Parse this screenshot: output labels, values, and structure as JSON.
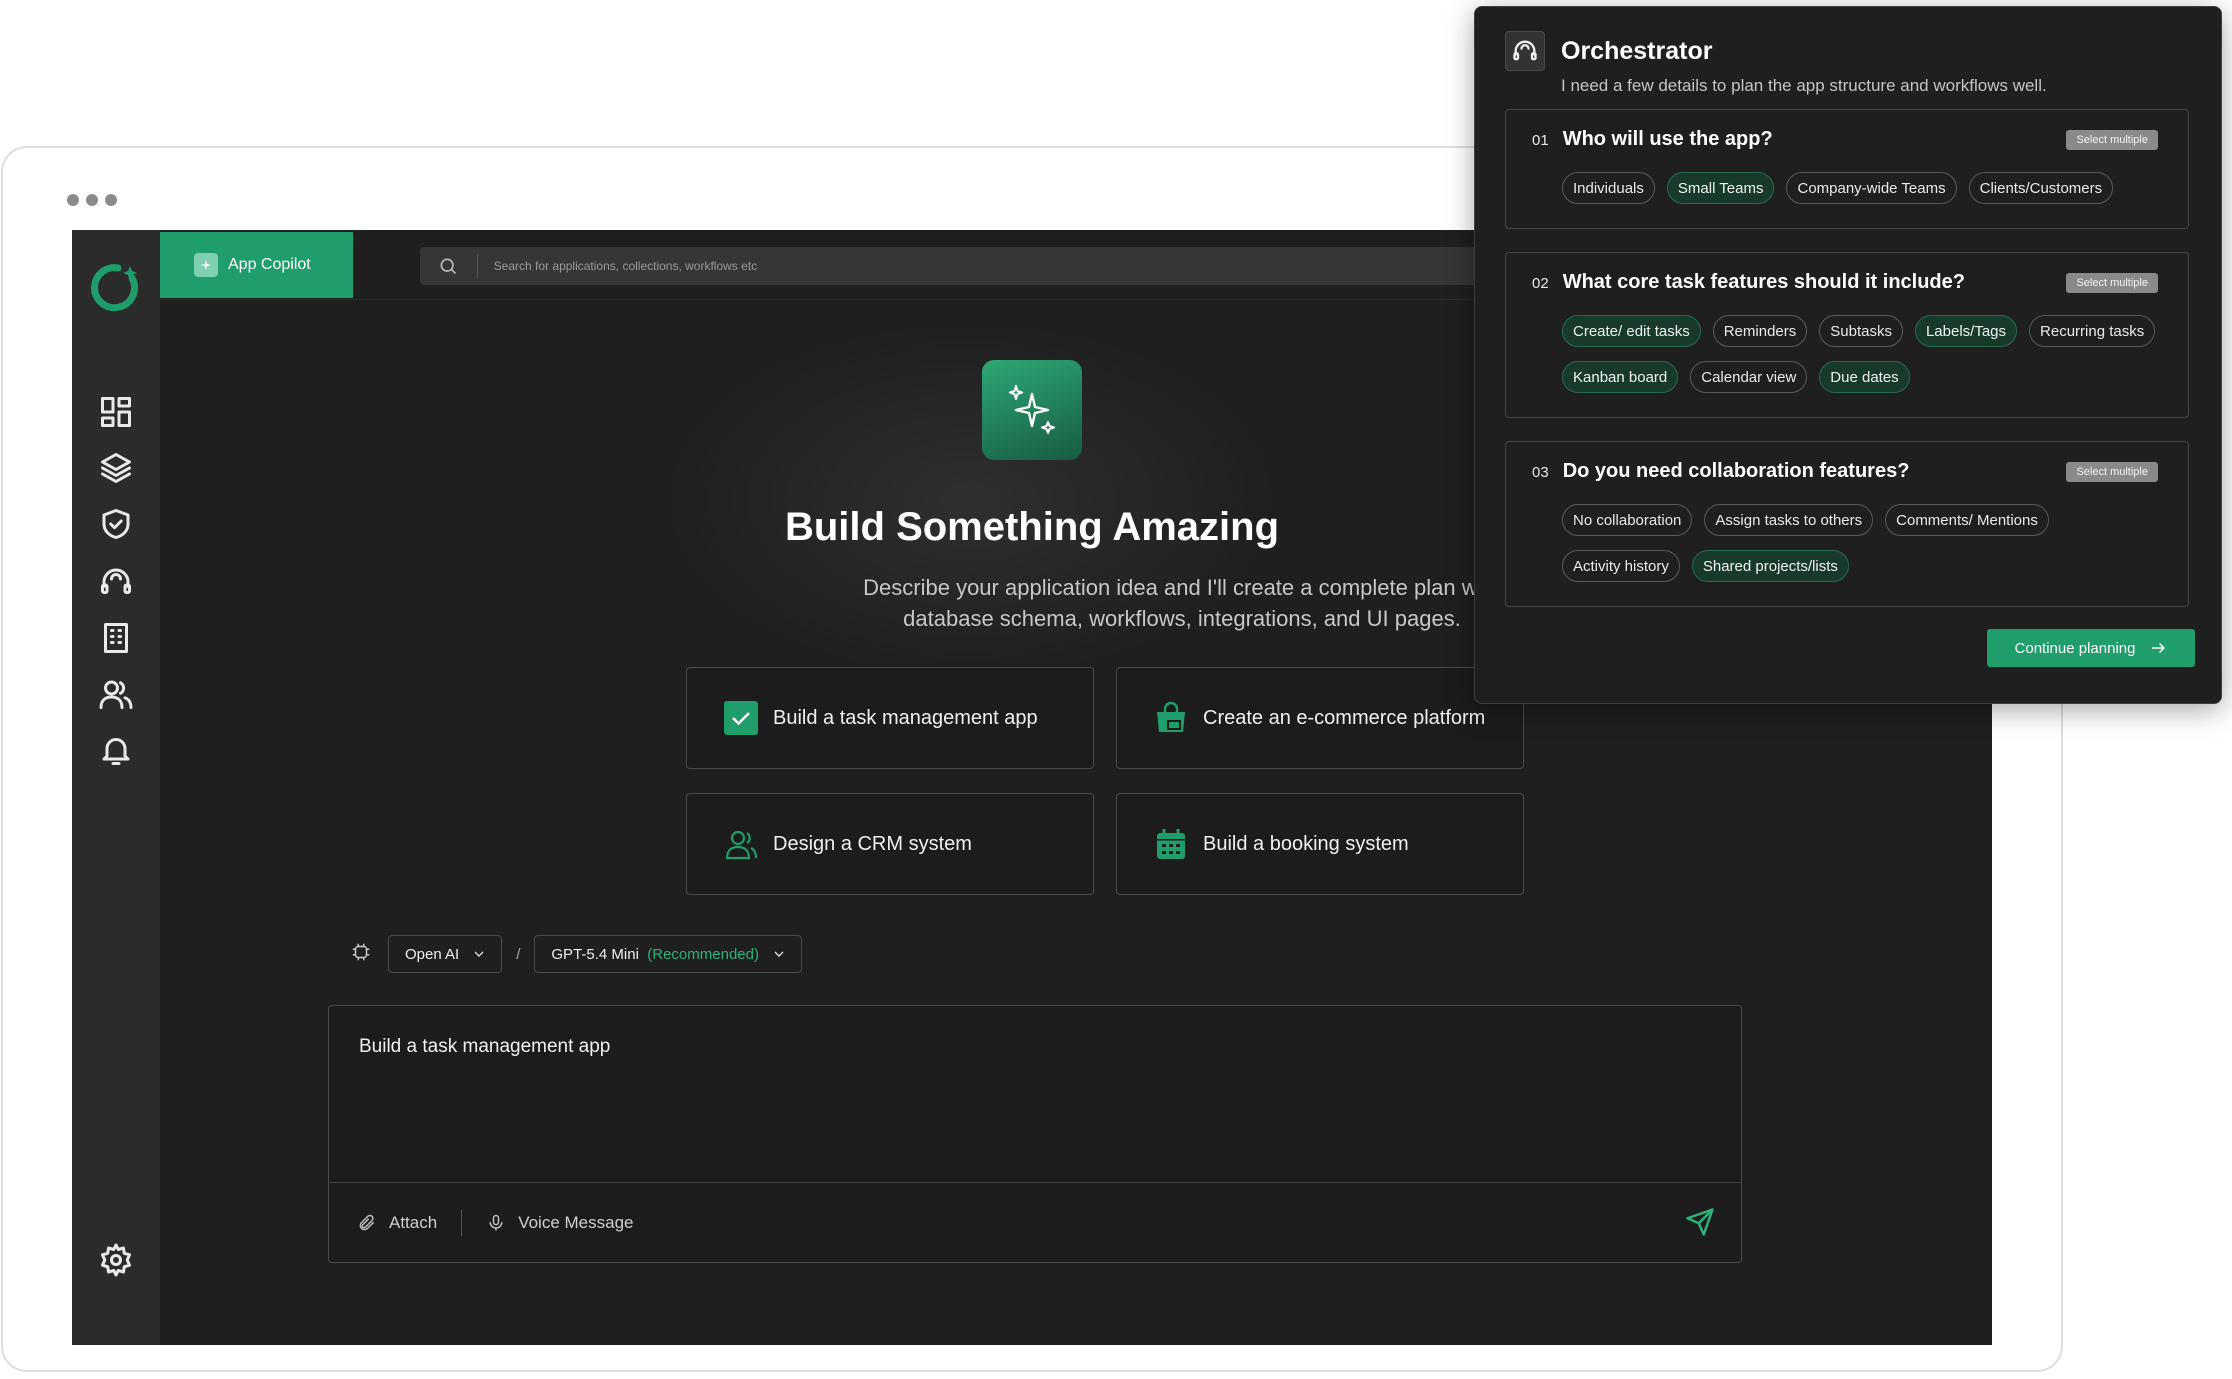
{
  "app": {
    "tab_label": "App Copilot",
    "search_placeholder": "Search for applications, collections, workflows etc"
  },
  "hero": {
    "title": "Build Something Amazing",
    "subtitle": "Describe your application idea and I'll create a complete plan with database schema, workflows, integrations, and UI pages."
  },
  "suggestions": [
    {
      "label": "Build a task management app",
      "icon": "checkbox-icon"
    },
    {
      "label": "Create an e-commerce platform",
      "icon": "shop-icon"
    },
    {
      "label": "Design a CRM system",
      "icon": "users-icon"
    },
    {
      "label": "Build a booking system",
      "icon": "calendar-icon"
    }
  ],
  "model": {
    "provider": "Open AI",
    "separator": "/",
    "model_name": "GPT-5.4 Mini",
    "recommended": "(Recommended)"
  },
  "composer": {
    "text": "Build a task management app",
    "attach_label": "Attach",
    "voice_label": "Voice Message"
  },
  "orchestrator": {
    "title": "Orchestrator",
    "subtitle": "I need a few details to plan the app structure and workflows well.",
    "continue_label": "Continue planning",
    "questions": [
      {
        "number": "01",
        "title": "Who will use the app?",
        "badge": "Select multiple",
        "options": [
          {
            "label": "Individuals",
            "selected": false
          },
          {
            "label": "Small Teams",
            "selected": true
          },
          {
            "label": "Company-wide Teams",
            "selected": false
          },
          {
            "label": "Clients/Customers",
            "selected": false
          }
        ]
      },
      {
        "number": "02",
        "title": "What core task features should it include?",
        "badge": "Select multiple",
        "options": [
          {
            "label": "Create/ edit tasks",
            "selected": true
          },
          {
            "label": "Reminders",
            "selected": false
          },
          {
            "label": "Subtasks",
            "selected": false
          },
          {
            "label": "Labels/Tags",
            "selected": true
          },
          {
            "label": "Recurring tasks",
            "selected": false
          },
          {
            "label": "Kanban board",
            "selected": true
          },
          {
            "label": "Calendar view",
            "selected": false
          },
          {
            "label": "Due dates",
            "selected": true
          }
        ]
      },
      {
        "number": "03",
        "title": "Do you need collaboration features?",
        "badge": "Select multiple",
        "options": [
          {
            "label": "No collaboration",
            "selected": false
          },
          {
            "label": "Assign tasks to others",
            "selected": false
          },
          {
            "label": "Comments/ Mentions",
            "selected": false
          },
          {
            "label": "Activity history",
            "selected": false
          },
          {
            "label": "Shared projects/lists",
            "selected": true
          }
        ]
      }
    ]
  },
  "colors": {
    "accent": "#1f9d6a",
    "sidebar": "#2b2b2b",
    "background": "#1f1f1f"
  }
}
